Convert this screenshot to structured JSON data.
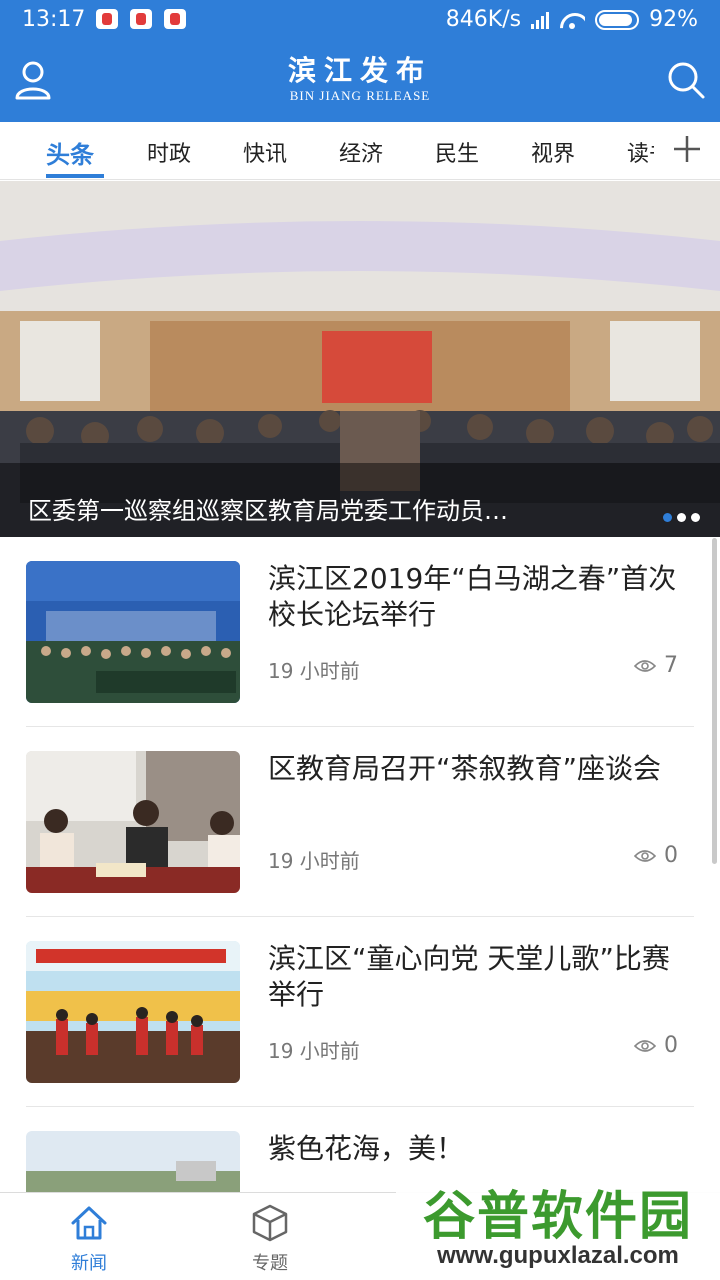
{
  "status_bar": {
    "time": "13:17",
    "network_speed": "846K/s",
    "battery": "92%",
    "battery_level": 0.92
  },
  "header": {
    "title_cn": "滨江发布",
    "title_en": "BIN JIANG RELEASE",
    "left_icon": "user-icon",
    "right_icon": "search-icon",
    "color": "#2f7ed8"
  },
  "tabs": [
    {
      "label": "头条",
      "active": true
    },
    {
      "label": "时政"
    },
    {
      "label": "快讯"
    },
    {
      "label": "经济"
    },
    {
      "label": "民生"
    },
    {
      "label": "视界"
    },
    {
      "label": "读书"
    }
  ],
  "banner": {
    "caption": "区委第一巡察组巡察区教育局党委工作动员…",
    "slide_count": 3,
    "active_slide": 1
  },
  "news": [
    {
      "title": "滨江区2019年“白马湖之春”首次校长论坛举行",
      "time": "19 小时前",
      "views": "7"
    },
    {
      "title": "区教育局召开“茶叙教育”座谈会",
      "time": "19 小时前",
      "views": "0"
    },
    {
      "title": "滨江区“童心向党 天堂儿歌”比赛举行",
      "time": "19 小时前",
      "views": "0"
    },
    {
      "title": "紫色花海，美！",
      "time": "",
      "views": ""
    }
  ],
  "bottom_nav": [
    {
      "label": "新闻",
      "icon": "home-icon",
      "active": true
    },
    {
      "label": "专题",
      "icon": "cube-icon"
    }
  ],
  "watermark": {
    "text": "谷普软件园",
    "url": "www.gupuxlazal.com"
  }
}
